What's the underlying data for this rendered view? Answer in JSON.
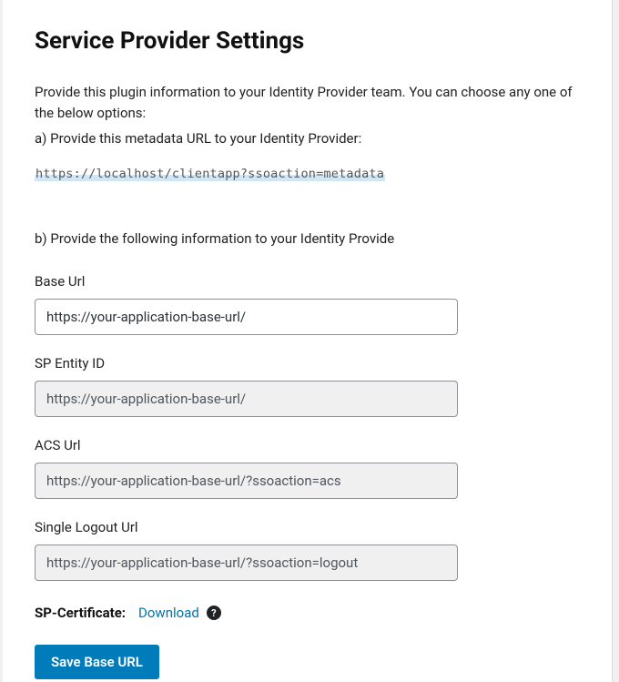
{
  "header": {
    "title": "Service Provider Settings"
  },
  "intro": {
    "text": "Provide this plugin information to your Identity Provider team. You can choose any one of the below options:",
    "option_a": "a) Provide this metadata URL to your Identity Provider:",
    "metadata_url": "https://localhost/clientapp?ssoaction=metadata",
    "option_b": "b) Provide the following information to your Identity Provide"
  },
  "fields": {
    "base_url": {
      "label": "Base Url",
      "value": "https://your-application-base-url/"
    },
    "sp_entity_id": {
      "label": "SP Entity ID",
      "value": "https://your-application-base-url/"
    },
    "acs_url": {
      "label": "ACS Url",
      "value": "https://your-application-base-url/?ssoaction=acs"
    },
    "slo_url": {
      "label": "Single Logout Url",
      "value": "https://your-application-base-url/?ssoaction=logout"
    }
  },
  "certificate": {
    "label": "SP-Certificate:",
    "download_label": "Download",
    "help_glyph": "?"
  },
  "actions": {
    "save_label": "Save Base URL"
  }
}
